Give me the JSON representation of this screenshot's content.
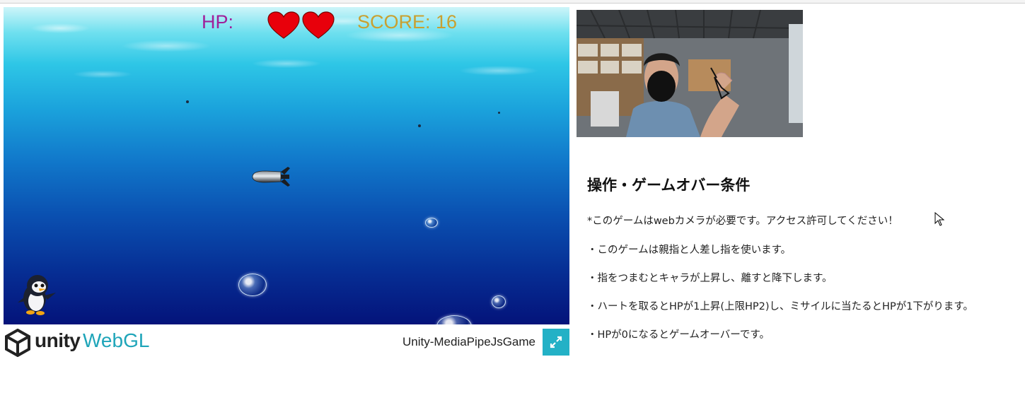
{
  "hud": {
    "hp_label": "HP:",
    "hp_value": 2,
    "score_label": "SCORE: 16"
  },
  "footer": {
    "brand": "unity",
    "platform": "WebGL",
    "game_title": "Unity-MediaPipeJsGame"
  },
  "instructions": {
    "heading": "操作・ゲームオバー条件",
    "lines": [
      "*このゲームはwebカメラが必要です。アクセス許可してください！",
      "・このゲームは親指と人差し指を使います。",
      "・指をつまむとキャラが上昇し、離すと降下します。",
      "・ハートを取るとHPが1上昇(上限HP2)し、ミサイルに当たるとHPが1下がります。",
      "・HPが0になるとゲームオーバーです。"
    ]
  },
  "colors": {
    "hp_label": "#a0209a",
    "score": "#c9a030",
    "heart": "#e8000b",
    "unity_accent": "#1fa5b9",
    "fullscreen_button": "#23b1c6"
  },
  "icons": [
    "heart-icon",
    "unity-logo-icon",
    "fullscreen-icon",
    "mouse-cursor-icon"
  ]
}
